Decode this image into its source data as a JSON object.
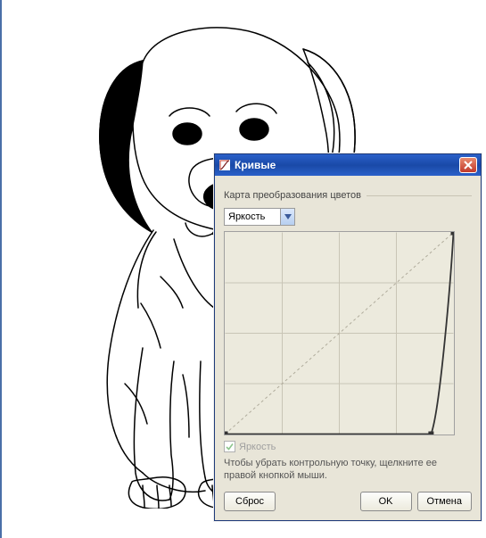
{
  "dialog": {
    "title": "Кривые",
    "group_label": "Карта преобразования цветов",
    "channel_selected": "Яркость",
    "brightness_checkbox_label": "Яркость",
    "brightness_checkbox_checked": true,
    "hint": "Чтобы убрать контрольную точку, щелкните ее правой кнопкой мыши.",
    "buttons": {
      "reset": "Сброс",
      "ok": "OK",
      "cancel": "Отмена"
    }
  },
  "chart_data": {
    "type": "line",
    "title": "",
    "xlabel": "",
    "ylabel": "",
    "xlim": [
      0,
      255
    ],
    "ylim": [
      0,
      255
    ],
    "grid": true,
    "reference_line": [
      [
        0,
        0
      ],
      [
        255,
        255
      ]
    ],
    "series": [
      {
        "name": "Яркость",
        "control_points": [
          {
            "x": 0,
            "y": 0
          },
          {
            "x": 230,
            "y": 0
          },
          {
            "x": 255,
            "y": 255
          }
        ]
      }
    ]
  }
}
